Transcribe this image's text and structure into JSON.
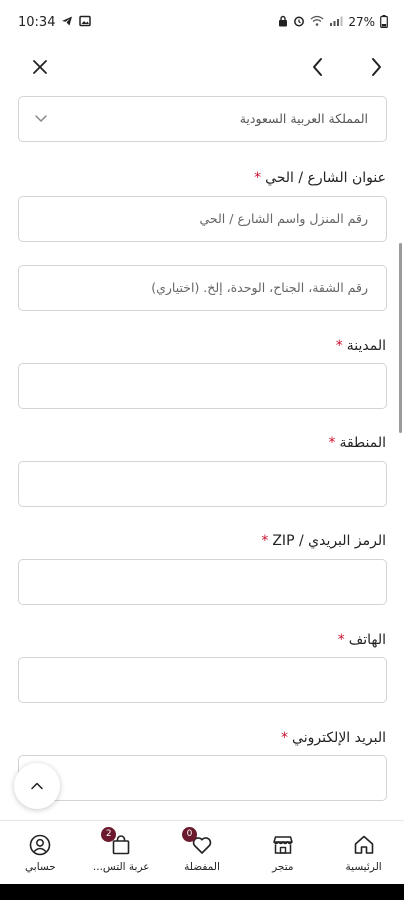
{
  "status_bar": {
    "time": "10:34",
    "battery": "27%"
  },
  "form": {
    "country_value": "المملكة العربية السعودية",
    "street_label": "عنوان الشارع / الحي",
    "street_placeholder": "رقم المنزل واسم الشارع / الحي",
    "apartment_placeholder": "رقم الشقة، الجناح، الوحدة، إلخ. (اختياري)",
    "city_label": "المدينة",
    "region_label": "المنطقة",
    "zip_label": "الرمز البريدي / ZIP",
    "phone_label": "الهاتف",
    "email_label": "البريد الإلكتروني",
    "required_mark": "*"
  },
  "bottom_nav": {
    "items": [
      {
        "label": "الرئيسية",
        "icon": "home-icon"
      },
      {
        "label": "متجر",
        "icon": "store-icon"
      },
      {
        "label": "المفضلة",
        "icon": "heart-icon",
        "badge": "0"
      },
      {
        "label": "عربة التس...",
        "icon": "shopping-bag-icon",
        "badge": "2"
      },
      {
        "label": "حسابي",
        "icon": "user-icon"
      }
    ]
  },
  "colors": {
    "accent": "#6b1a2e",
    "required": "#c8102e"
  }
}
